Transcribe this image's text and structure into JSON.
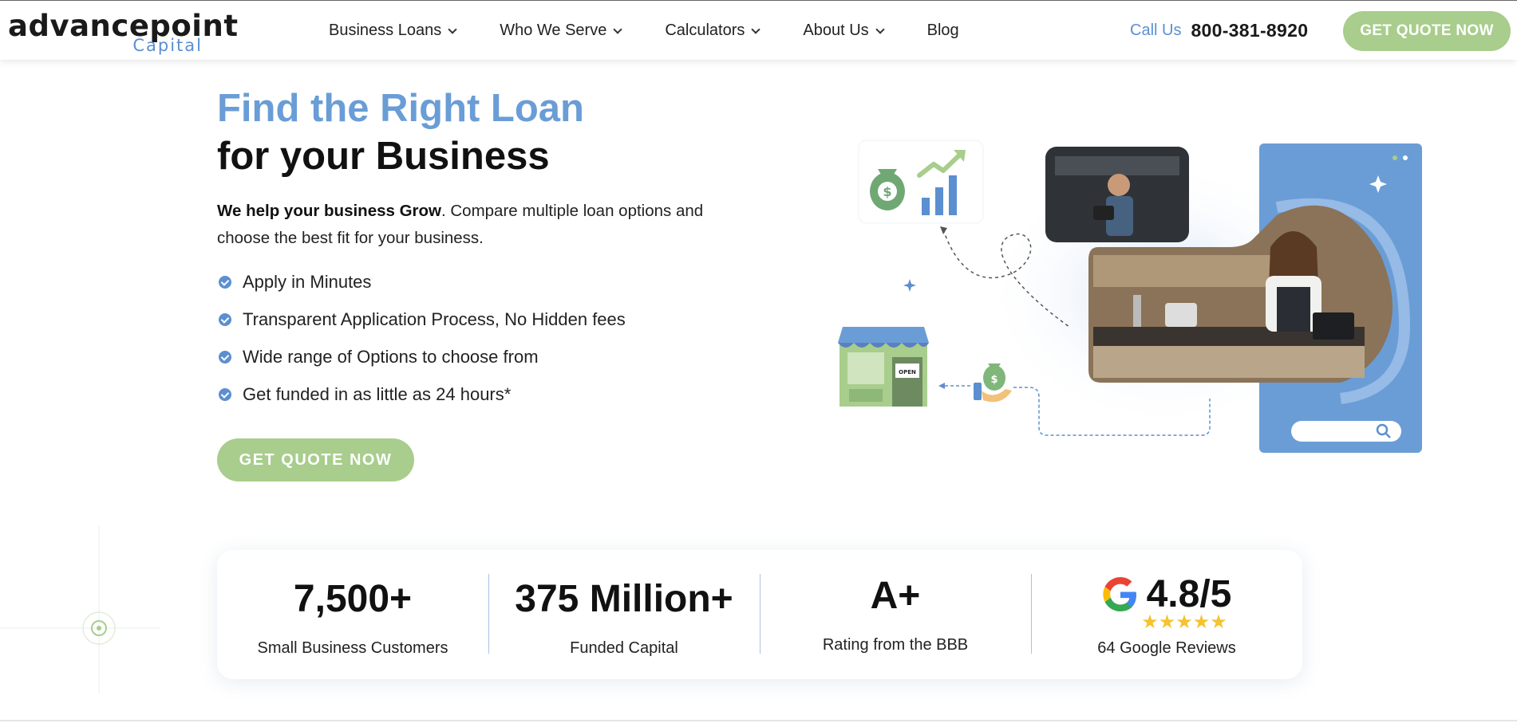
{
  "header": {
    "logo": {
      "main": "advancepoint",
      "sub": "Capital"
    },
    "nav": [
      {
        "label": "Business Loans",
        "dropdown": true
      },
      {
        "label": "Who We Serve",
        "dropdown": true
      },
      {
        "label": "Calculators",
        "dropdown": true
      },
      {
        "label": "About Us",
        "dropdown": true
      },
      {
        "label": "Blog",
        "dropdown": false
      }
    ],
    "call_label": "Call Us",
    "phone": "800-381-8920",
    "cta_label": "GET QUOTE NOW"
  },
  "hero": {
    "title_line1": "Find the Right Loan",
    "title_line2": "for your Business",
    "desc_bold": "We help your business Grow",
    "desc_rest": ". Compare multiple loan options and choose the best fit for your business.",
    "bullets": [
      "Apply in Minutes",
      "Transparent Application Process, No Hidden fees",
      "Wide range of Options to choose from",
      "Get funded in as little as 24 hours*"
    ],
    "cta_label": "GET QUOTE NOW",
    "illustration_sign": "OPEN"
  },
  "stats": [
    {
      "value": "7,500+",
      "label": "Small Business Customers"
    },
    {
      "value": "375 Million+",
      "label": "Funded Capital"
    },
    {
      "value": "A+",
      "label": "Rating from the BBB"
    },
    {
      "value": "4.8/5",
      "label": "64 Google Reviews",
      "stars": "★★★★★",
      "rating": 4.8
    }
  ],
  "colors": {
    "brand_blue": "#5b8fd0",
    "cta_green": "#a8cd8c",
    "star_yellow": "#f5c330"
  },
  "icons": [
    "chevron-down-icon",
    "check-circle-icon",
    "google-icon",
    "star-icon",
    "search-icon",
    "money-bag-icon",
    "growth-chart-icon",
    "storefront-icon"
  ]
}
